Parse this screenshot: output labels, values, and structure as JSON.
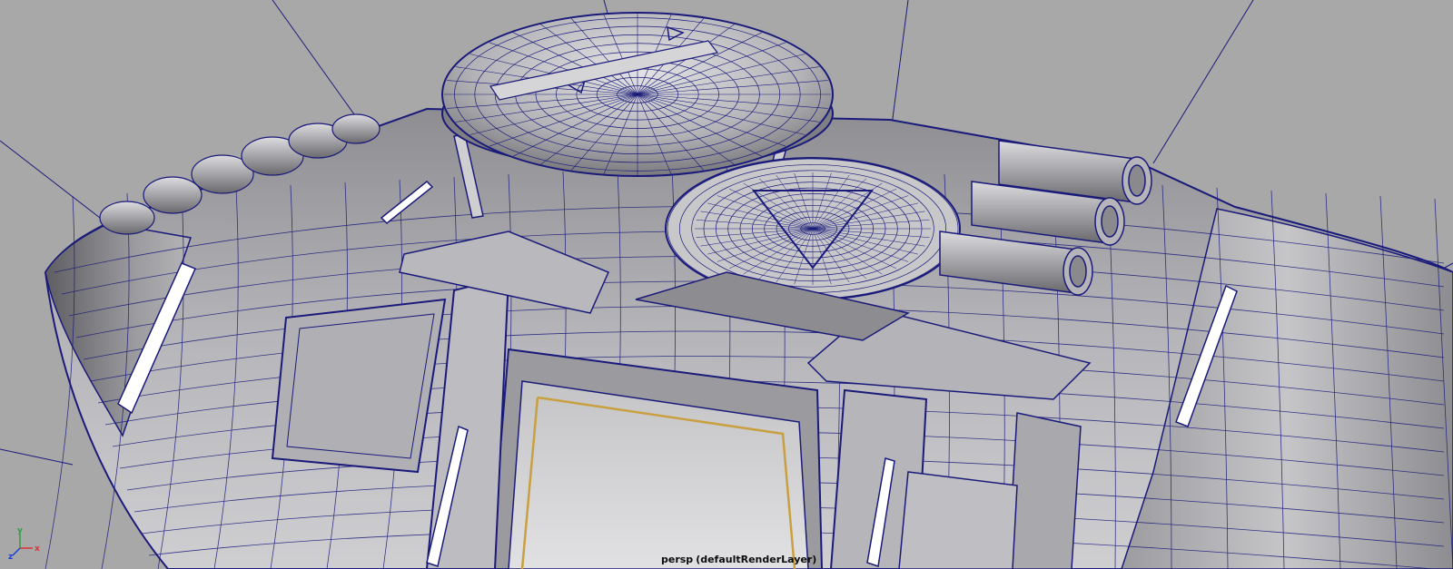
{
  "viewport": {
    "camera_name": "persp",
    "render_layer": "(defaultRenderLayer)",
    "display_mode": "wireframe-on-shaded"
  },
  "axis_gizmo": {
    "x_label": "x",
    "y_label": "y",
    "z_label": "z",
    "x_color": "#e03131",
    "y_color": "#2f9e44",
    "z_color": "#1c3fd6"
  },
  "colors": {
    "background": "#a8a8a8",
    "wire": "#1a1a7a",
    "highlight_wire": "#c8a040",
    "surface_light": "#c9c9cc",
    "surface_mid": "#9a9a9e",
    "surface_dark": "#6c6c70",
    "camera_label": "#0b0b0b"
  },
  "icons": {
    "axis_gizmo": "xyz-axis-icon"
  }
}
